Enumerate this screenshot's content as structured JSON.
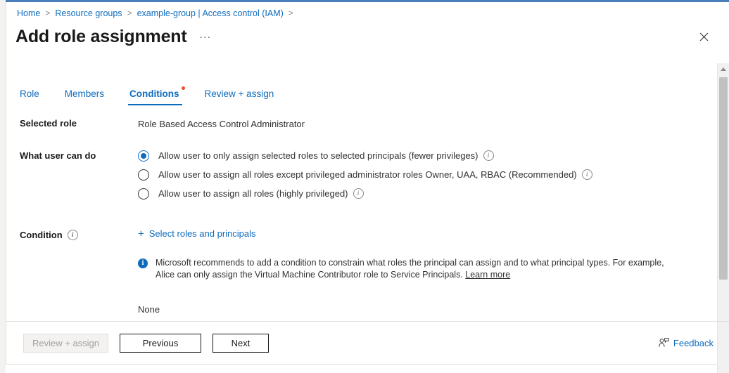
{
  "breadcrumb": {
    "items": [
      "Home",
      "Resource groups",
      "example-group | Access control (IAM)"
    ],
    "separator": ">"
  },
  "header": {
    "title": "Add role assignment",
    "ellipsis": "...",
    "close_icon": "close-icon"
  },
  "tabs": [
    {
      "label": "Role",
      "active": false,
      "badge": false
    },
    {
      "label": "Members",
      "active": false,
      "badge": false
    },
    {
      "label": "Conditions",
      "active": true,
      "badge": true
    },
    {
      "label": "Review + assign",
      "active": false,
      "badge": false
    }
  ],
  "form": {
    "selected_role": {
      "label": "Selected role",
      "value": "Role Based Access Control Administrator"
    },
    "what_user_can_do": {
      "label": "What user can do",
      "options": [
        {
          "text": "Allow user to only assign selected roles to selected principals (fewer privileges)",
          "selected": true,
          "info": true
        },
        {
          "text": "Allow user to assign all roles except privileged administrator roles Owner, UAA, RBAC (Recommended)",
          "selected": false,
          "info": true
        },
        {
          "text": "Allow user to assign all roles (highly privileged)",
          "selected": false,
          "info": true
        }
      ]
    },
    "condition": {
      "label": "Condition",
      "info": true,
      "add_link": "Select roles and principals",
      "add_icon": "plus-icon",
      "banner": {
        "icon": "info-filled-icon",
        "text": "Microsoft recommends to add a condition to constrain what roles the principal can assign and to what principal types. For example, Alice can only assign the Virtual Machine Contributor role to Service Principals.",
        "link": "Learn more"
      },
      "value": "None"
    }
  },
  "footer": {
    "review_assign": "Review + assign",
    "previous": "Previous",
    "next": "Next",
    "feedback": "Feedback",
    "feedback_icon": "person-feedback-icon"
  },
  "colors": {
    "accent": "#0f6cbd",
    "top_accent": "#4a7ebb",
    "badge": "#e8502a",
    "text": "#323130",
    "panel": "#ffffff"
  },
  "scrollbar": {
    "up_arrow_icon": "chevron-up-icon"
  }
}
